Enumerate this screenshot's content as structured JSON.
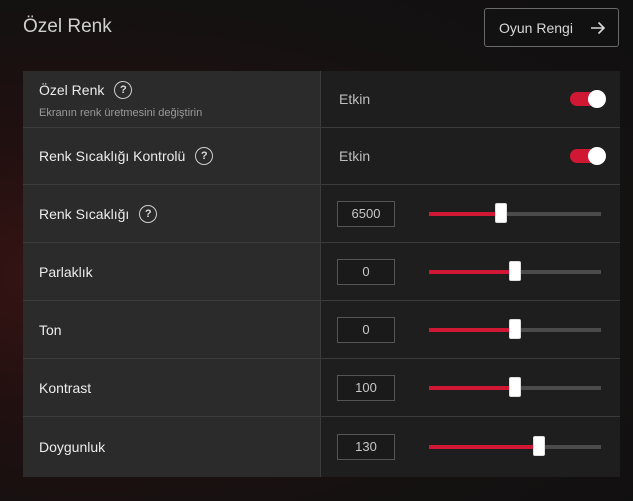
{
  "header": {
    "title": "Özel Renk",
    "game_color_button": "Oyun Rengi",
    "arrow_icon": "arrow-right-icon"
  },
  "colors": {
    "accent": "#d01734",
    "panel_left": "#2b2b2b",
    "panel_right": "#1e1e1e"
  },
  "rows": {
    "custom_color": {
      "label": "Özel Renk",
      "description": "Ekranın renk üretmesini değiştirin",
      "state": "Etkin",
      "enabled": true
    },
    "temp_control": {
      "label": "Renk Sıcaklığı Kontrolü",
      "state": "Etkin",
      "enabled": true
    },
    "temperature": {
      "label": "Renk Sıcaklığı",
      "value": "6500",
      "level": 0.42
    },
    "brightness": {
      "label": "Parlaklık",
      "value": "0",
      "level": 0.5
    },
    "hue": {
      "label": "Ton",
      "value": "0",
      "level": 0.5
    },
    "contrast": {
      "label": "Kontrast",
      "value": "100",
      "level": 0.5
    },
    "saturation": {
      "label": "Doygunluk",
      "value": "130",
      "level": 0.64
    }
  },
  "help_icon_glyph": "?"
}
